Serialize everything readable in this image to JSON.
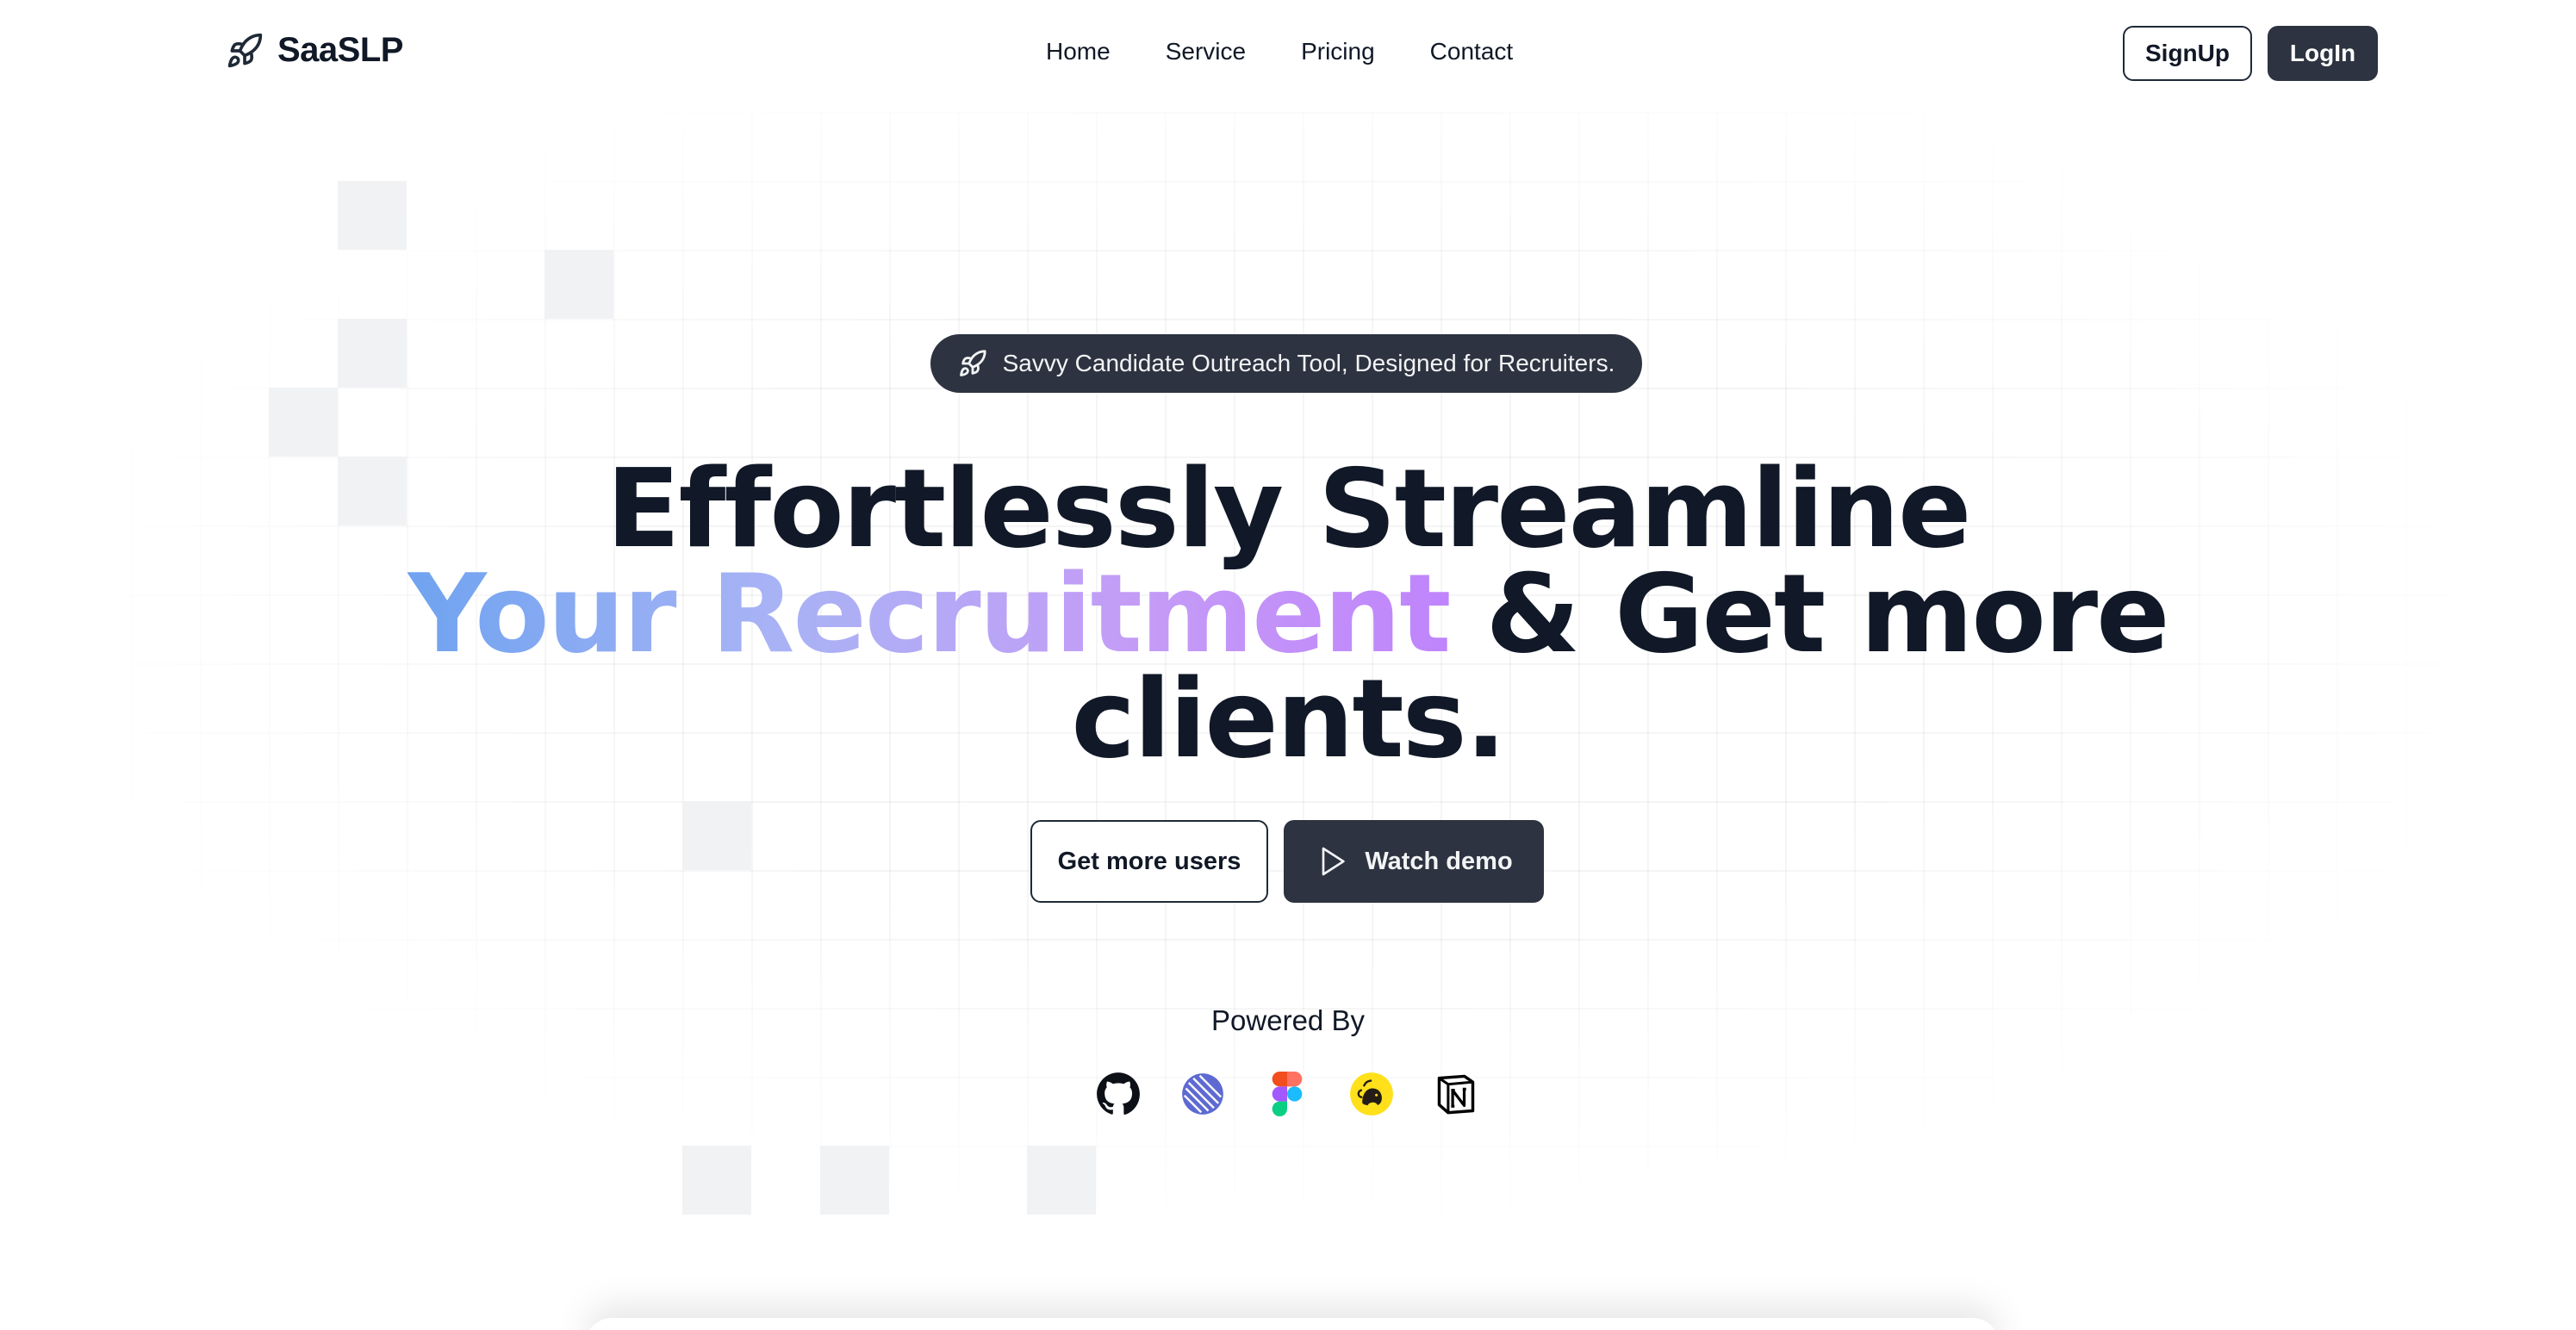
{
  "brand": {
    "name": "SaaSLP",
    "icon": "rocket-icon"
  },
  "nav": {
    "links": [
      "Home",
      "Service",
      "Pricing",
      "Contact"
    ]
  },
  "auth": {
    "signup_label": "SignUp",
    "login_label": "LogIn"
  },
  "hero": {
    "badge_icon": "rocket-icon",
    "badge_text": "Savvy Candidate Outreach Tool, Designed for Recruiters.",
    "headline_line1": "Effortlessly Streamline",
    "headline_gradient": "Your Recruitment",
    "headline_line2_rest": "& Get more",
    "headline_line3": "clients.",
    "cta_primary": "Get more users",
    "cta_secondary": "Watch demo",
    "cta_secondary_icon": "play-icon"
  },
  "powered_by": {
    "label": "Powered By",
    "logos": [
      "github-logo",
      "linear-logo",
      "figma-logo",
      "mailchimp-logo",
      "notion-logo"
    ]
  },
  "colors": {
    "dark": "#2d3340",
    "text": "#111827",
    "gradient_start": "#6fa3f0",
    "gradient_end": "#c084fc"
  }
}
